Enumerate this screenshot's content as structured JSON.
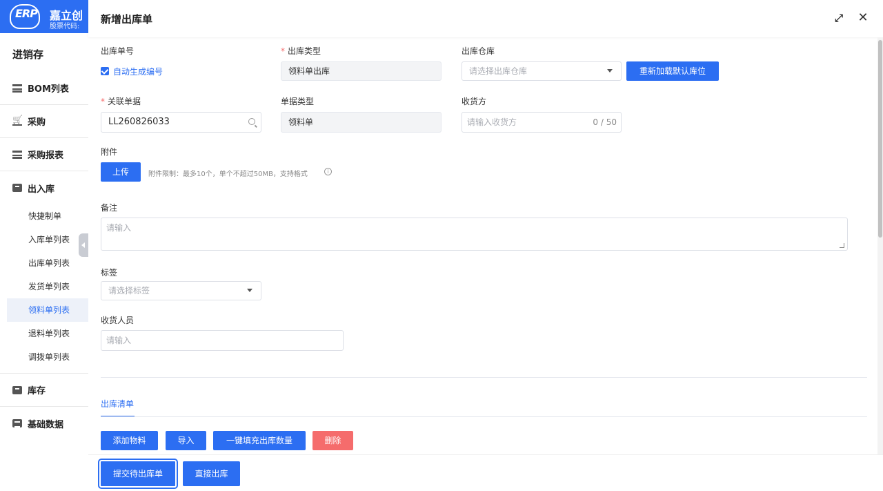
{
  "logo": {
    "mark": "ERP",
    "title": "嘉立创",
    "subtitle": "股票代码:"
  },
  "sidebar": {
    "heading": "进销存",
    "groups": [
      {
        "label": "BOM列表",
        "icon": "list-icon"
      },
      {
        "label": "采购",
        "icon": "cart-icon"
      },
      {
        "label": "采购报表",
        "icon": "list-icon"
      },
      {
        "label": "出入库",
        "icon": "box-icon"
      }
    ],
    "sub_items": [
      "快捷制单",
      "入库单列表",
      "出库单列表",
      "发货单列表",
      "领料单列表",
      "退料单列表",
      "调拨单列表"
    ],
    "active_sub": "领料单列表",
    "groups_after": [
      {
        "label": "库存",
        "icon": "box-icon"
      },
      {
        "label": "基础数据",
        "icon": "doc-icon"
      }
    ]
  },
  "drawer": {
    "title": "新增出库单",
    "form": {
      "order_no_label": "出库单号",
      "auto_gen_label": "自动生成编号",
      "out_type_label": "出库类型",
      "out_type_value": "领料单出库",
      "warehouse_label": "出库仓库",
      "warehouse_placeholder": "请选择出库仓库",
      "reload_button": "重新加载默认库位",
      "related_label": "关联单据",
      "related_value": "LL260826033",
      "doc_type_label": "单据类型",
      "doc_type_value": "领料单",
      "receiver_label": "收货方",
      "receiver_placeholder": "请输入收货方",
      "receiver_count": "0 / 50",
      "attach_label": "附件",
      "upload_button": "上传",
      "attach_hint": "附件限制：最多10个，单个不超过50MB，支持格式",
      "remark_label": "备注",
      "remark_placeholder": "请输入",
      "tag_label": "标签",
      "tag_placeholder": "请选择标签",
      "receiver_person_label": "收货人员",
      "receiver_person_placeholder": "请输入"
    },
    "tab_label": "出库清单",
    "list_buttons": {
      "add": "添加物料",
      "import": "导入",
      "fill": "一键填充出库数量",
      "delete": "删除"
    },
    "footer_buttons": {
      "submit": "提交待出库单",
      "direct": "直接出库"
    }
  },
  "colors": {
    "primary": "#2c6ef2",
    "danger": "#f56c6c",
    "required": "#f56c6c"
  }
}
